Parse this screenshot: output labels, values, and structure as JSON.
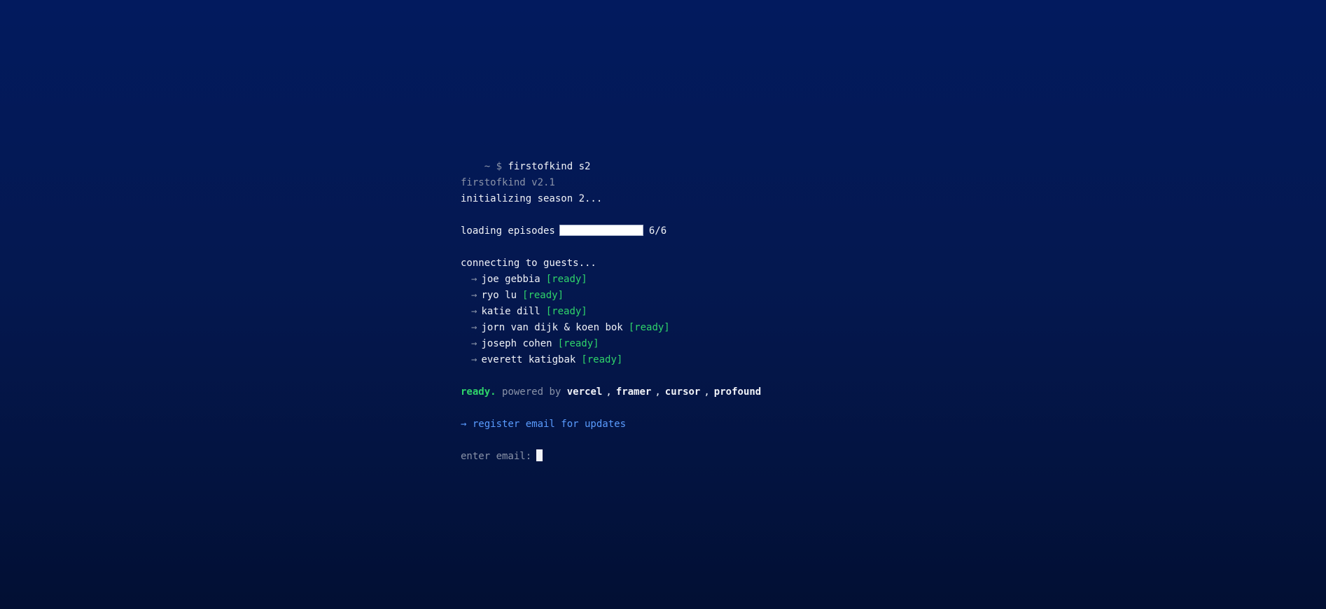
{
  "prompt": {
    "symbol": "~ $",
    "command": "firstofkind s2"
  },
  "version": "firstofkind v2.1",
  "init_message": "initializing season 2...",
  "loading": {
    "label": "loading episodes",
    "progress": 1.0,
    "count": "6/6"
  },
  "connecting_message": "connecting to guests...",
  "guest_arrow": "→",
  "guests": [
    {
      "name": "joe gebbia",
      "status": "[ready]"
    },
    {
      "name": "ryo lu",
      "status": "[ready]"
    },
    {
      "name": "katie dill",
      "status": "[ready]"
    },
    {
      "name": "jorn van dijk & koen bok",
      "status": "[ready]"
    },
    {
      "name": "joseph cohen",
      "status": "[ready]"
    },
    {
      "name": "everett katigbak",
      "status": "[ready]"
    }
  ],
  "footer": {
    "ready": "ready.",
    "powered_by": "powered by",
    "separator": ",",
    "sponsors": [
      "vercel",
      "framer",
      "cursor",
      "profound"
    ]
  },
  "register_link": "→ register email for updates",
  "email": {
    "label": "enter email:",
    "value": ""
  },
  "colors": {
    "ready_green": "#2fd46a",
    "link_blue": "#5a9cff",
    "dim_text": "#8a93a8",
    "bg_top": "#021a5e",
    "bg_bottom": "#020f33"
  }
}
